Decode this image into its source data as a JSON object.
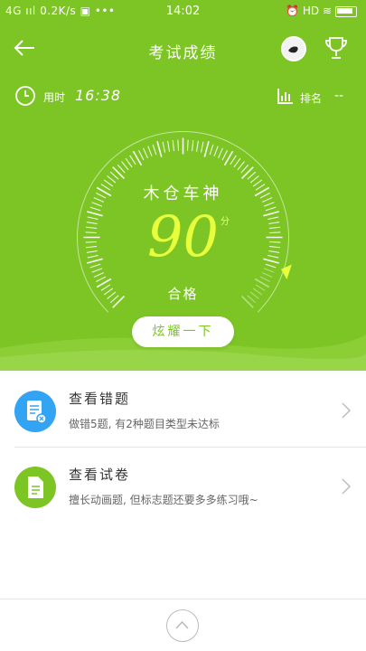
{
  "status_bar": {
    "left": "4G ııl 0.2K/s ▣ •••",
    "time": "14:02",
    "right": "⏰ HD ≋"
  },
  "header": {
    "title": "考试成绩"
  },
  "timer": {
    "label": "用时",
    "value": "16:38"
  },
  "rank": {
    "label": "排名",
    "value": "--"
  },
  "gauge": {
    "title": "木仓车神",
    "score": "90",
    "unit": "分",
    "result": "合格",
    "level": 0.9
  },
  "show_button": {
    "label": "炫耀一下"
  },
  "menu": [
    {
      "title": "查看错题",
      "desc": "做错5题, 有2种题目类型未达标",
      "color": "#33a3f4",
      "icon": "wrong-questions-icon"
    },
    {
      "title": "查看试卷",
      "desc": "擅长动画题, 但标志题还要多多练习哦~",
      "color": "#7cc524",
      "icon": "exam-paper-icon"
    }
  ],
  "colors": {
    "accent": "#7cc524",
    "blue": "#33a3f4",
    "score": "#e8ff3c"
  }
}
